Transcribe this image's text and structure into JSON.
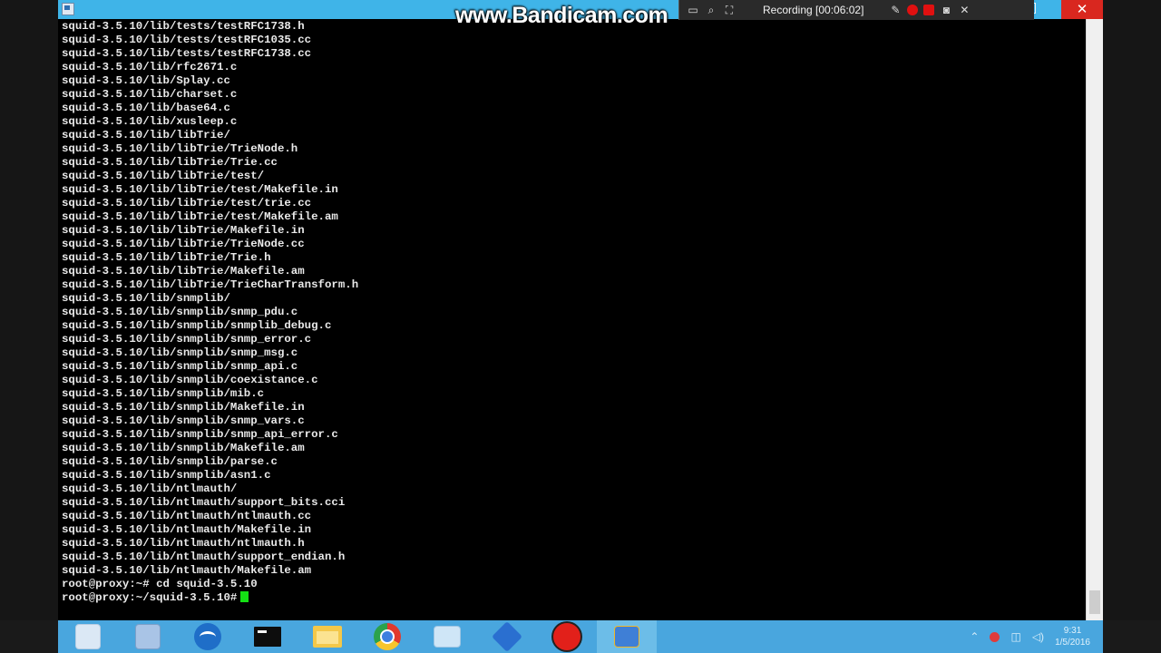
{
  "watermark": "www.Bandicam.com",
  "recorder": {
    "status": "Recording [00:06:02]",
    "icons": [
      "monitor-icon",
      "search-icon",
      "fullscreen-icon",
      "pencil-icon",
      "record-icon",
      "stop-icon",
      "camera-icon",
      "close-icon"
    ]
  },
  "window": {
    "close_glyph": "✕"
  },
  "terminal": {
    "lines": [
      "squid-3.5.10/lib/tests/testRFC1738.h",
      "squid-3.5.10/lib/tests/testRFC1035.cc",
      "squid-3.5.10/lib/tests/testRFC1738.cc",
      "squid-3.5.10/lib/rfc2671.c",
      "squid-3.5.10/lib/Splay.cc",
      "squid-3.5.10/lib/charset.c",
      "squid-3.5.10/lib/base64.c",
      "squid-3.5.10/lib/xusleep.c",
      "squid-3.5.10/lib/libTrie/",
      "squid-3.5.10/lib/libTrie/TrieNode.h",
      "squid-3.5.10/lib/libTrie/Trie.cc",
      "squid-3.5.10/lib/libTrie/test/",
      "squid-3.5.10/lib/libTrie/test/Makefile.in",
      "squid-3.5.10/lib/libTrie/test/trie.cc",
      "squid-3.5.10/lib/libTrie/test/Makefile.am",
      "squid-3.5.10/lib/libTrie/Makefile.in",
      "squid-3.5.10/lib/libTrie/TrieNode.cc",
      "squid-3.5.10/lib/libTrie/Trie.h",
      "squid-3.5.10/lib/libTrie/Makefile.am",
      "squid-3.5.10/lib/libTrie/TrieCharTransform.h",
      "squid-3.5.10/lib/snmplib/",
      "squid-3.5.10/lib/snmplib/snmp_pdu.c",
      "squid-3.5.10/lib/snmplib/snmplib_debug.c",
      "squid-3.5.10/lib/snmplib/snmp_error.c",
      "squid-3.5.10/lib/snmplib/snmp_msg.c",
      "squid-3.5.10/lib/snmplib/snmp_api.c",
      "squid-3.5.10/lib/snmplib/coexistance.c",
      "squid-3.5.10/lib/snmplib/mib.c",
      "squid-3.5.10/lib/snmplib/Makefile.in",
      "squid-3.5.10/lib/snmplib/snmp_vars.c",
      "squid-3.5.10/lib/snmplib/snmp_api_error.c",
      "squid-3.5.10/lib/snmplib/Makefile.am",
      "squid-3.5.10/lib/snmplib/parse.c",
      "squid-3.5.10/lib/snmplib/asn1.c",
      "squid-3.5.10/lib/ntlmauth/",
      "squid-3.5.10/lib/ntlmauth/support_bits.cci",
      "squid-3.5.10/lib/ntlmauth/ntlmauth.cc",
      "squid-3.5.10/lib/ntlmauth/Makefile.in",
      "squid-3.5.10/lib/ntlmauth/ntlmauth.h",
      "squid-3.5.10/lib/ntlmauth/support_endian.h",
      "squid-3.5.10/lib/ntlmauth/Makefile.am",
      "root@proxy:~# cd squid-3.5.10"
    ],
    "prompt": "root@proxy:~/squid-3.5.10#",
    "cursor_color": "#14e014",
    "fg_color": "#e9e9e9",
    "bg_color": "#000000"
  },
  "taskbar": {
    "apps": [
      {
        "name": "taskbar-app-1",
        "icon": "i-folder-ghost",
        "active": false
      },
      {
        "name": "taskbar-app-2",
        "icon": "i-doc",
        "active": false
      },
      {
        "name": "taskbar-app-3",
        "icon": "i-phone",
        "active": false
      },
      {
        "name": "taskbar-app-4",
        "icon": "i-term",
        "active": false
      },
      {
        "name": "taskbar-app-5",
        "icon": "i-explorer",
        "active": false
      },
      {
        "name": "taskbar-app-6",
        "icon": "i-chrome",
        "active": false
      },
      {
        "name": "taskbar-app-7",
        "icon": "i-files",
        "active": false
      },
      {
        "name": "taskbar-app-8",
        "icon": "i-cube",
        "active": false
      },
      {
        "name": "taskbar-app-9",
        "icon": "i-rec",
        "active": false
      },
      {
        "name": "taskbar-app-10",
        "icon": "i-network",
        "active": true
      }
    ],
    "tray": {
      "time": "9:31",
      "date": "1/5/2016"
    },
    "color": "#49a6de"
  }
}
